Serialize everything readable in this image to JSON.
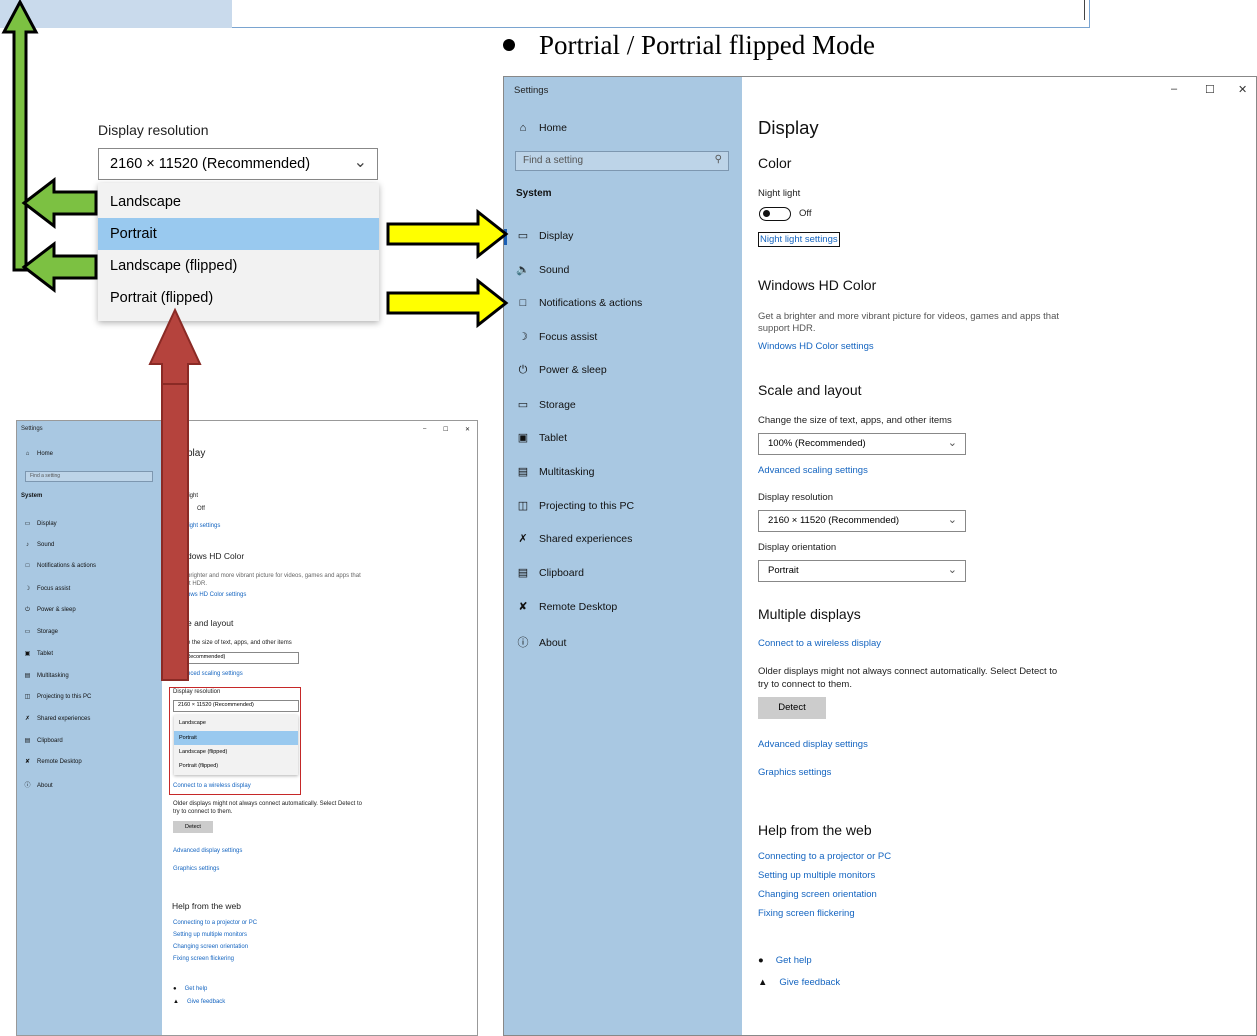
{
  "heading": "Portrial / Portrial flipped Mode",
  "zoom": {
    "label": "Display resolution",
    "selected": "2160 × 11520 (Recommended)",
    "options": [
      "Landscape",
      "Portrait",
      "Landscape (flipped)",
      "Portrait (flipped)"
    ],
    "highlighted": "Portrait"
  },
  "window": {
    "title": "Settings",
    "controls": [
      "–",
      "☐",
      "✕"
    ],
    "sidebar": {
      "home": "Home",
      "search_placeholder": "Find a setting",
      "section": "System",
      "items": [
        {
          "label": "Display",
          "icon": "monitor-icon"
        },
        {
          "label": "Sound",
          "icon": "speaker-icon"
        },
        {
          "label": "Notifications & actions",
          "icon": "notification-icon"
        },
        {
          "label": "Focus assist",
          "icon": "moon-icon"
        },
        {
          "label": "Power & sleep",
          "icon": "power-icon"
        },
        {
          "label": "Storage",
          "icon": "storage-icon"
        },
        {
          "label": "Tablet",
          "icon": "tablet-icon"
        },
        {
          "label": "Multitasking",
          "icon": "multitasking-icon"
        },
        {
          "label": "Projecting to this PC",
          "icon": "projector-icon"
        },
        {
          "label": "Shared experiences",
          "icon": "shared-icon"
        },
        {
          "label": "Clipboard",
          "icon": "clipboard-icon"
        },
        {
          "label": "Remote Desktop",
          "icon": "remote-icon"
        },
        {
          "label": "About",
          "icon": "info-icon"
        }
      ]
    },
    "main": {
      "title": "Display",
      "color_heading": "Color",
      "night_light_label": "Night light",
      "night_light_state": "Off",
      "night_light_settings": "Night light settings",
      "hd_heading": "Windows HD Color",
      "hd_desc_1": "Get a brighter and more vibrant picture for videos, games and apps that",
      "hd_desc_2": "support HDR.",
      "hd_link": "Windows HD Color settings",
      "scale_heading": "Scale and layout",
      "scale_label": "Change the size of text, apps, and other items",
      "scale_value": "100% (Recommended)",
      "adv_scaling": "Advanced scaling settings",
      "res_label": "Display resolution",
      "res_value": "2160 × 11520 (Recommended)",
      "orient_label": "Display orientation",
      "orient_value": "Portrait",
      "multi_heading": "Multiple displays",
      "wireless_link": "Connect to a wireless display",
      "older_1": "Older displays might not always connect automatically. Select Detect to",
      "older_2": "try to connect to them.",
      "detect": "Detect",
      "adv_display": "Advanced display settings",
      "graphics": "Graphics settings",
      "help_heading": "Help from the web",
      "help_links": [
        "Connecting to a projector or PC",
        "Setting up multiple monitors",
        "Changing screen orientation",
        "Fixing screen flickering"
      ],
      "get_help": "Get help",
      "feedback": "Give feedback"
    }
  },
  "small_window": {
    "title": "Settings",
    "home": "Home",
    "search_placeholder": "Find a setting",
    "section": "System",
    "items": [
      "Display",
      "Sound",
      "Notifications & actions",
      "Focus assist",
      "Power & sleep",
      "Storage",
      "Tablet",
      "Multitasking",
      "Projecting to this PC",
      "Shared experiences",
      "Clipboard",
      "Remote Desktop",
      "About"
    ],
    "title_partial": "play",
    "color_partial": "r",
    "night_partial": "light",
    "off": "Off",
    "night_link_partial": "light settings",
    "hd_partial": "dows HD Color",
    "hd_desc_partial": "brighter and more vibrant picture for videos, games and apps that",
    "hdr_partial": "rt HDR.",
    "hd_link_partial": "ows HD Color settings",
    "scale_partial": "e and layout",
    "scale_label_partial": "e the size of text, apps, and other items",
    "scale_value_partial": "% (Recommended)",
    "adv_scaling_partial": "nced scaling settings",
    "res_label": "Display resolution",
    "res_value": "2160 × 11520 (Recommended)",
    "options": [
      "Landscape",
      "Portrait",
      "Landscape (flipped)",
      "Portrait (flipped)"
    ],
    "wireless_link": "Connect to a wireless display",
    "older_1": "Older displays might not always connect automatically. Select Detect to",
    "older_2": "try to connect to them.",
    "detect": "Detect",
    "adv_display": "Advanced display settings",
    "graphics": "Graphics settings",
    "help_heading": "Help from the web",
    "help_links": [
      "Connecting to a projector or PC",
      "Setting up multiple monitors",
      "Changing screen orientation",
      "Fixing screen flickering"
    ],
    "get_help": "Get help",
    "feedback": "Give feedback"
  },
  "colors": {
    "sidebar_bg": "#a9c8e2",
    "highlight": "#99c9ef",
    "link": "#1565c0",
    "arrow_green": "#7cc142",
    "arrow_yellow": "#ffff00",
    "arrow_red": "#b5433d",
    "redbox": "#c62828"
  }
}
